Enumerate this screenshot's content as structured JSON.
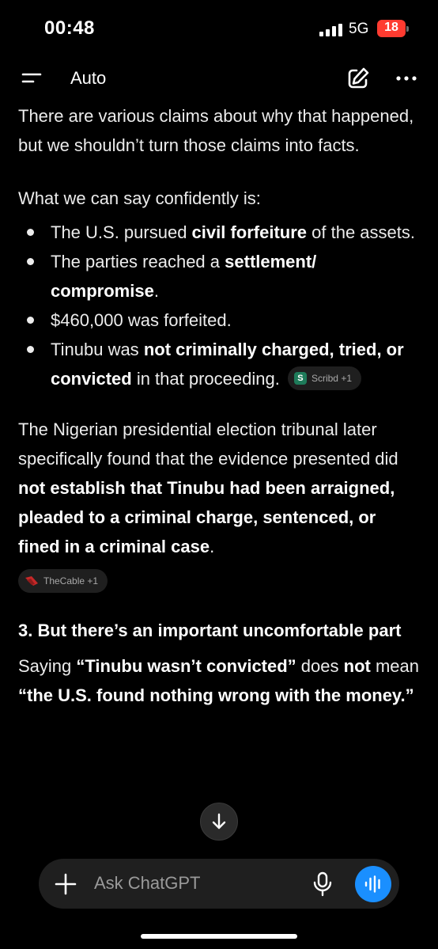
{
  "status": {
    "time": "00:48",
    "network": "5G",
    "battery": "18"
  },
  "header": {
    "title": "Auto",
    "icons": [
      "menu-icon",
      "edit-icon",
      "more-icon"
    ]
  },
  "content": {
    "p1": "There are various claims about why that happened, but we shouldn’t turn those claims into facts.",
    "p2": "What we can say confidently is:",
    "b1": {
      "pre": "The U.S. pursued ",
      "bold": "civil forfeiture",
      "post": " of the assets."
    },
    "b2": {
      "pre": "The parties reached a ",
      "bold": "settlement/ compromise",
      "post": "."
    },
    "b3": {
      "text": "$460,000 was forfeited."
    },
    "b4": {
      "pre": "Tinubu was ",
      "bold": "not criminally charged, tried, or convicted",
      "post": " in that proceeding."
    },
    "chip1": {
      "icon": "S",
      "label": "Scribd +1"
    },
    "p3": {
      "pre": "The Nigerian presidential election tribunal later specifically found that the evidence presented did ",
      "bold": "not establish that Tinubu had been arraigned, pleaded to a criminal charge, sentenced, or fined in a criminal case",
      "post": "."
    },
    "chip2": {
      "label": "TheCable +1"
    },
    "heading": "3. But there’s an important uncomfortable part",
    "p4": {
      "pre": "Saying ",
      "bold1": "“Tinubu wasn’t convicted”",
      "mid1": " does ",
      "bold2": "not",
      "mid2": " mean ",
      "bold3": "“the U.S. found nothing wrong with the money.”"
    }
  },
  "composer": {
    "placeholder": "Ask ChatGPT"
  },
  "colors": {
    "background": "#000000",
    "accent": "#1a8fff",
    "battery": "#ff3b30",
    "composer": "#1f1f1f"
  }
}
